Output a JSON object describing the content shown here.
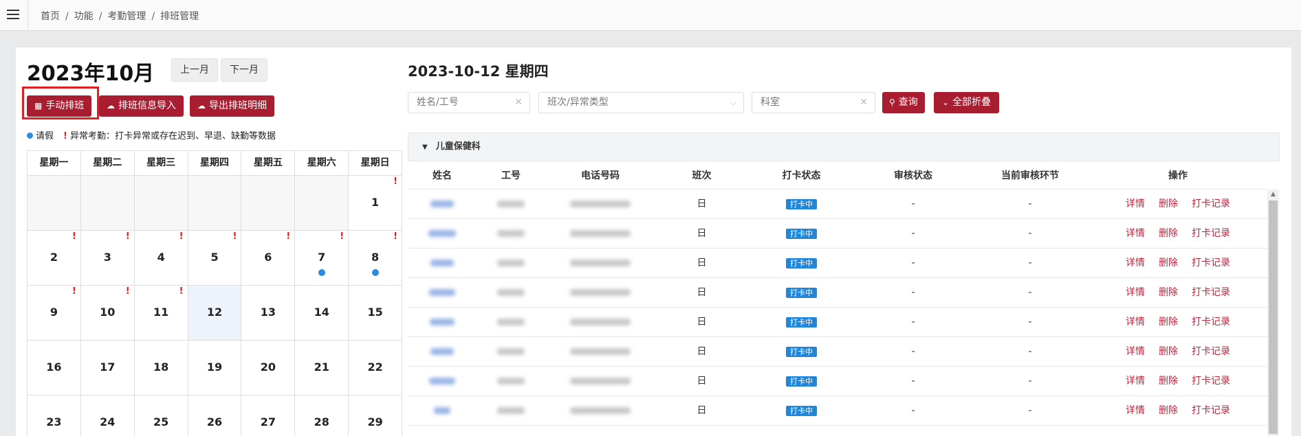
{
  "breadcrumb": [
    "首页",
    "功能",
    "考勤管理",
    "排班管理"
  ],
  "month_title": "2023年10月",
  "nav": {
    "prev": "上一月",
    "next": "下一月"
  },
  "actions": {
    "manual": "手动排班",
    "import": "排班信息导入",
    "export": "导出排班明细"
  },
  "legend": {
    "leave": "请假",
    "abnormal": "异常考勤：打卡异常或存在迟到、早退、缺勤等数据"
  },
  "weekdays": [
    "星期一",
    "星期二",
    "星期三",
    "星期四",
    "星期五",
    "星期六",
    "星期日"
  ],
  "calendar": {
    "today": 12,
    "weeks": [
      [
        null,
        null,
        null,
        null,
        null,
        null,
        1
      ],
      [
        2,
        3,
        4,
        5,
        6,
        7,
        8
      ],
      [
        9,
        10,
        11,
        12,
        13,
        14,
        15
      ],
      [
        16,
        17,
        18,
        19,
        20,
        21,
        22
      ],
      [
        23,
        24,
        25,
        26,
        27,
        28,
        29
      ]
    ],
    "abnormal_days": [
      1,
      2,
      3,
      4,
      5,
      6,
      7,
      8,
      9,
      10,
      11
    ],
    "leave_days": [
      7,
      8
    ]
  },
  "detail_date": "2023-10-12 星期四",
  "filters": {
    "name_placeholder": "姓名/工号",
    "shift_placeholder": "班次/异常类型",
    "dept_placeholder": "科室",
    "query": "查询",
    "collapse": "全部折叠"
  },
  "group": "儿童保健科",
  "columns": [
    "姓名",
    "工号",
    "电话号码",
    "班次",
    "打卡状态",
    "审核状态",
    "当前审核环节",
    "操作"
  ],
  "rows": [
    {
      "shift": "日",
      "status": "打卡中",
      "review": "-",
      "step": "-"
    },
    {
      "shift": "日",
      "status": "打卡中",
      "review": "-",
      "step": "-"
    },
    {
      "shift": "日",
      "status": "打卡中",
      "review": "-",
      "step": "-"
    },
    {
      "shift": "日",
      "status": "打卡中",
      "review": "-",
      "step": "-"
    },
    {
      "shift": "日",
      "status": "打卡中",
      "review": "-",
      "step": "-"
    },
    {
      "shift": "日",
      "status": "打卡中",
      "review": "-",
      "step": "-"
    },
    {
      "shift": "日",
      "status": "打卡中",
      "review": "-",
      "step": "-"
    },
    {
      "shift": "日",
      "status": "打卡中",
      "review": "-",
      "step": "-"
    }
  ],
  "row_ops": [
    "详情",
    "删除",
    "打卡记录"
  ],
  "icons": {
    "menu": "hamburger-icon",
    "calendar": "calendar-icon",
    "upload": "cloud-upload-icon",
    "download": "cloud-download-icon",
    "search": "search-icon",
    "collapse": "chevron-down-icon",
    "clear": "close-icon"
  },
  "colors": {
    "primary": "#a81d30",
    "leave": "#2b8be0",
    "abnormal": "#e02020",
    "status": "#1f86d9"
  }
}
